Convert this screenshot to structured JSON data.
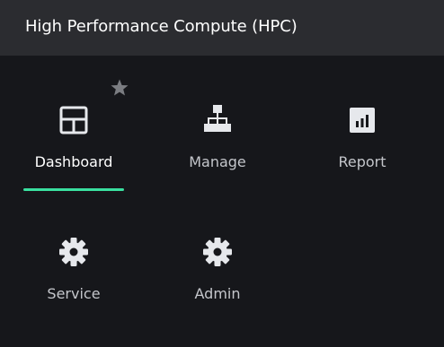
{
  "app": {
    "title": "High Performance Compute (HPC)"
  },
  "colors": {
    "header_bg": "#2b2c30",
    "page_bg": "#16171b",
    "active_indicator": "#3ae0a0",
    "icon_color": "#e6e8ec",
    "star_color": "#7b7d82"
  },
  "favorite": {
    "icon": "star-icon"
  },
  "tiles": [
    {
      "label": "Dashboard",
      "icon": "dashboard-layout-icon",
      "active": true
    },
    {
      "label": "Manage",
      "icon": "sitemap-icon",
      "active": false
    },
    {
      "label": "Report",
      "icon": "bar-chart-icon",
      "active": false
    },
    {
      "label": "Service",
      "icon": "gear-icon",
      "active": false
    },
    {
      "label": "Admin",
      "icon": "gear-icon",
      "active": false
    }
  ]
}
